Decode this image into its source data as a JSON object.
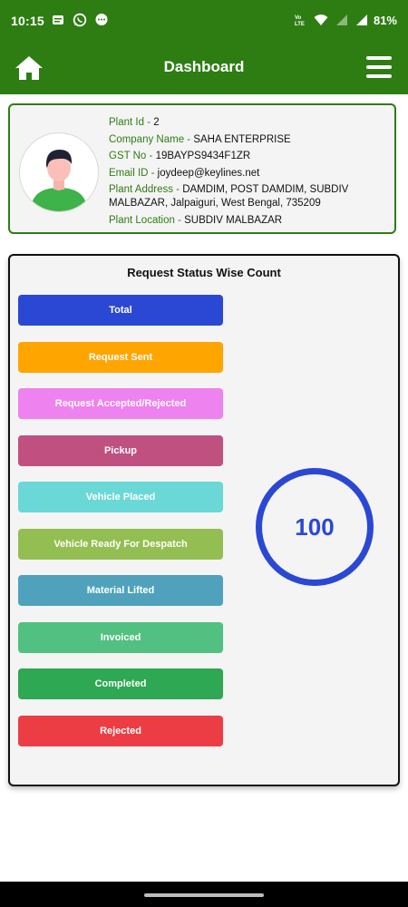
{
  "status_bar": {
    "time": "10:15",
    "battery": "81%",
    "left_icons": [
      "message-icon",
      "whatsapp-icon",
      "chat-icon"
    ],
    "right_icons": [
      "volte-icon",
      "wifi-icon",
      "signal-5g-icon",
      "signal-icon"
    ]
  },
  "app_bar": {
    "title": "Dashboard",
    "color": "#2e7d13"
  },
  "profile": {
    "plant_id_label": "Plant Id - ",
    "plant_id": "2",
    "company_name_label": "Company Name - ",
    "company_name": "SAHA ENTERPRISE",
    "gst_label": "GST No - ",
    "gst": "19BAYPS9434F1ZR",
    "email_label": "Email ID - ",
    "email": "joydeep@keylines.net",
    "address_label": "Plant Address - ",
    "address": "DAMDIM, POST DAMDIM, SUBDIV MALBAZAR, Jalpaiguri, West Bengal, 735209",
    "location_label": "Plant Location - ",
    "location": "SUBDIV MALBAZAR"
  },
  "status_section": {
    "title": "Request Status Wise Count",
    "count": "100",
    "count_color": "#2a48d4",
    "buttons": [
      {
        "label": "Total",
        "color": "#2a48d4"
      },
      {
        "label": "Request Sent",
        "color": "#ffa500"
      },
      {
        "label": "Request Accepted/Rejected",
        "color": "#ee82ee"
      },
      {
        "label": "Pickup",
        "color": "#c05080"
      },
      {
        "label": "Vehicle Placed",
        "color": "#6ad8d6"
      },
      {
        "label": "Vehicle Ready For Despatch",
        "color": "#93bf52"
      },
      {
        "label": "Material Lifted",
        "color": "#50a2bc"
      },
      {
        "label": "Invoiced",
        "color": "#52c080"
      },
      {
        "label": "Completed",
        "color": "#2ea852"
      },
      {
        "label": "Rejected",
        "color": "#ec3d44"
      }
    ]
  }
}
